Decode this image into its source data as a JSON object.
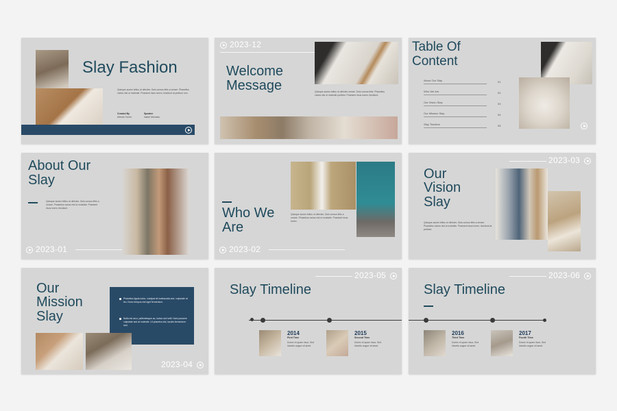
{
  "colors": {
    "title": "#1f4a5c",
    "navy": "#294a67",
    "slide_bg": "#d6d6d6",
    "page_bg": "#f3f3f3"
  },
  "slide1": {
    "title": "Slay Fashion",
    "body": "Quisque auctor tellus ut ultricies. Duis cursus felis a ornare. Phasellus varius nisl ut molestie. Praesent risus lorem, tincidunt at pretium non.",
    "created_by_label": "Created By",
    "created_by_name": "Alfredo Torres",
    "speaker_label": "Speaker",
    "speaker_name": "Isabel Mercado"
  },
  "slide2": {
    "year": "2023-12",
    "title_line1": "Welcome",
    "title_line2": "Message",
    "body": "Quisque auctor tellus ut ultricies ornare. Duis cursus felis. Phasellus varius nisl ut molestie porttitor. Praesent risus lorem, tincidunt."
  },
  "slide3": {
    "title_line1": "Table Of",
    "title_line2": "Content",
    "items": [
      {
        "label": "About Our Slay",
        "num": "01"
      },
      {
        "label": "Who We Are",
        "num": "02"
      },
      {
        "label": "Our Vision Slay",
        "num": "03"
      },
      {
        "label": "Our Mission Slay",
        "num": "04"
      },
      {
        "label": "Slay Timeline",
        "num": "05"
      }
    ]
  },
  "slide4": {
    "title_line1": "About Our",
    "title_line2": "Slay",
    "body": "Quisque auctor tellus ut ultricies. Duis cursus felis a ornare. Phasellus varius nisl ut molestie. Praesent risus lorem, tincidunt.",
    "year": "2023-01"
  },
  "slide5": {
    "title_line1": "Who We",
    "title_line2": "Are",
    "body": "Quisque auctor tellus ut ultricies. Duis cursus felis a ornare. Phasellus varius nisl ut molestie. Praesent risus lorem.",
    "year": "2023-02"
  },
  "slide6": {
    "year": "2023-03",
    "title_line1": "Our",
    "title_line2": "Vision",
    "title_line3": "Slay",
    "body": "Quisque auctor tellus ut ultricies. Duis cursus felis a ornare. Phasellus varius nisl ut molestie. Praesent risus lorem, tincidunt at pretium."
  },
  "slide7": {
    "title_line1": "Our",
    "title_line2": "Mission",
    "title_line3": "Slay",
    "bullet1": "Phasellus ligula tortor, volutpat sit malesuada sed, vulputate at leo. Nunc tempus nisl eget fermentum.",
    "bullet2": "Nulla est arcu, pellentesque ac, luctus sed velit. Nam posuere vulputate sed at molestie. Ut pharetra nisi, iaculis fermentum sed.",
    "year": "2023-04"
  },
  "slide8": {
    "year": "2023-05",
    "title": "Slay Timeline",
    "events": [
      {
        "year": "2014",
        "sub": "First Time",
        "body": "Donec et quam risus. Sed lobortis augue sit amet."
      },
      {
        "year": "2015",
        "sub": "Second Time",
        "body": "Donec et quam risus. Sed lobortis augue sit amet."
      }
    ]
  },
  "slide9": {
    "year": "2023-06",
    "title": "Slay Timeline",
    "events": [
      {
        "year": "2016",
        "sub": "Third Time",
        "body": "Donec et quam risus. Sed lobortis augue sit amet."
      },
      {
        "year": "2017",
        "sub": "Fourth Time",
        "body": "Donec et quam risus. Sed lobortis augue sit amet."
      }
    ]
  }
}
